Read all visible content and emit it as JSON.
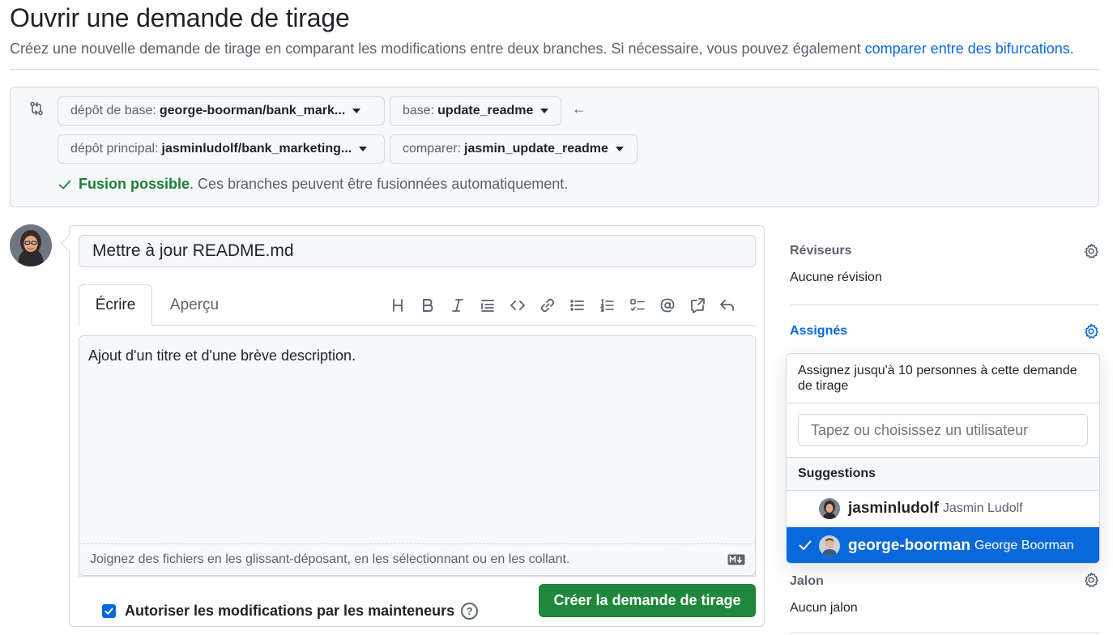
{
  "page": {
    "title": "Ouvrir une demande de tirage",
    "subtitle": "Créez une nouvelle demande de tirage en comparant les modifications entre deux branches. Si nécessaire, vous pouvez également",
    "subtitle_link": "comparer entre des bifurcations",
    "subtitle_end": "."
  },
  "compare": {
    "base_repo_label": "dépôt de base:",
    "base_repo_value": "george-boorman/bank_mark...",
    "base_label": "base:",
    "base_value": "update_readme",
    "head_repo_label": "dépôt principal:",
    "head_repo_value": "jasminludolf/bank_marketing...",
    "compare_label": "comparer:",
    "compare_value": "jasmin_update_readme",
    "arrow": "←",
    "merge_ok": "Fusion possible",
    "merge_text": ". Ces branches peuvent être fusionnées automatiquement."
  },
  "editor": {
    "title_value": "Mettre à jour README.md",
    "tab_write": "Écrire",
    "tab_preview": "Aperçu",
    "body_text": "Ajout d'un titre et d'une brève description.",
    "attach_hint": "Joignez des fichiers en les glissant-déposant, en les sélectionnant ou en les collant.",
    "allow_edits_label": "Autoriser les modifications par les mainteneurs",
    "help": "?",
    "create_button": "Créer la demande de tirage"
  },
  "sidebar": {
    "reviewers_heading": "Réviseurs",
    "reviewers_value": "Aucune révision",
    "assignees_heading": "Assignés",
    "milestone_heading": "Jalon",
    "milestone_value": "Aucun jalon"
  },
  "assignee_dropdown": {
    "header": "Assignez jusqu'à 10 personnes à cette demande de tirage",
    "filter_placeholder": "Tapez ou choisissez un utilisateur",
    "section": "Suggestions",
    "users": [
      {
        "login": "jasminludolf",
        "name": "Jasmin Ludolf",
        "selected": false
      },
      {
        "login": "george-boorman",
        "name": "George Boorman",
        "selected": true
      }
    ]
  },
  "colors": {
    "accent": "#0969da",
    "success": "#1f883d",
    "success_text": "#1a7f37",
    "border": "#d1d9e0",
    "muted": "#59636e"
  }
}
